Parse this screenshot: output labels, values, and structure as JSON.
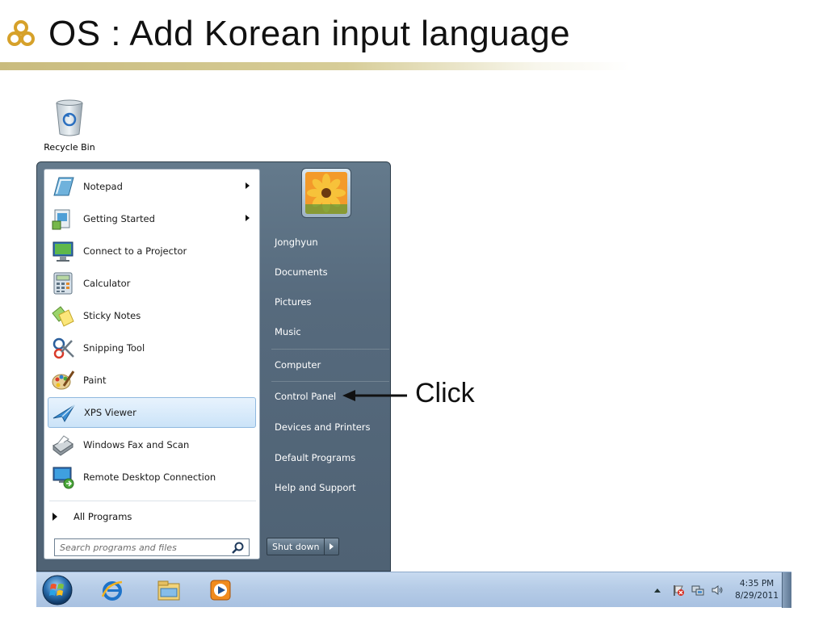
{
  "slide": {
    "title": "OS : Add Korean input language",
    "bullet_icon": "trefoil-bullet-icon",
    "accent_color": "#d6a12a"
  },
  "desktop": {
    "recycle_bin_label": "Recycle Bin"
  },
  "start_menu": {
    "programs": [
      {
        "label": "Notepad",
        "icon": "notepad-icon",
        "has_submenu": true
      },
      {
        "label": "Getting Started",
        "icon": "getting-started-icon",
        "has_submenu": true
      },
      {
        "label": "Connect to a Projector",
        "icon": "projector-icon",
        "has_submenu": false
      },
      {
        "label": "Calculator",
        "icon": "calculator-icon",
        "has_submenu": false
      },
      {
        "label": "Sticky Notes",
        "icon": "sticky-notes-icon",
        "has_submenu": false
      },
      {
        "label": "Snipping Tool",
        "icon": "snipping-tool-icon",
        "has_submenu": false
      },
      {
        "label": "Paint",
        "icon": "paint-icon",
        "has_submenu": false
      },
      {
        "label": "XPS Viewer",
        "icon": "xps-viewer-icon",
        "has_submenu": false,
        "selected": true
      },
      {
        "label": "Windows Fax and Scan",
        "icon": "fax-scan-icon",
        "has_submenu": false
      },
      {
        "label": "Remote Desktop Connection",
        "icon": "remote-desktop-icon",
        "has_submenu": false
      }
    ],
    "all_programs_label": "All Programs",
    "search_placeholder": "Search programs and files",
    "right_items": [
      {
        "label": "Jonghyun"
      },
      {
        "label": "Documents"
      },
      {
        "label": "Pictures"
      },
      {
        "label": "Music"
      },
      {
        "label": "Computer"
      },
      {
        "label": "Control Panel"
      },
      {
        "label": "Devices and Printers"
      },
      {
        "label": "Default Programs"
      },
      {
        "label": "Help and Support"
      }
    ],
    "shutdown_label": "Shut down"
  },
  "annotation": {
    "text": "Click"
  },
  "taskbar": {
    "pinned": [
      "start-orb-icon",
      "internet-explorer-icon",
      "windows-explorer-icon",
      "media-player-icon"
    ],
    "clock_time": "4:35 PM",
    "clock_date": "8/29/2011"
  }
}
